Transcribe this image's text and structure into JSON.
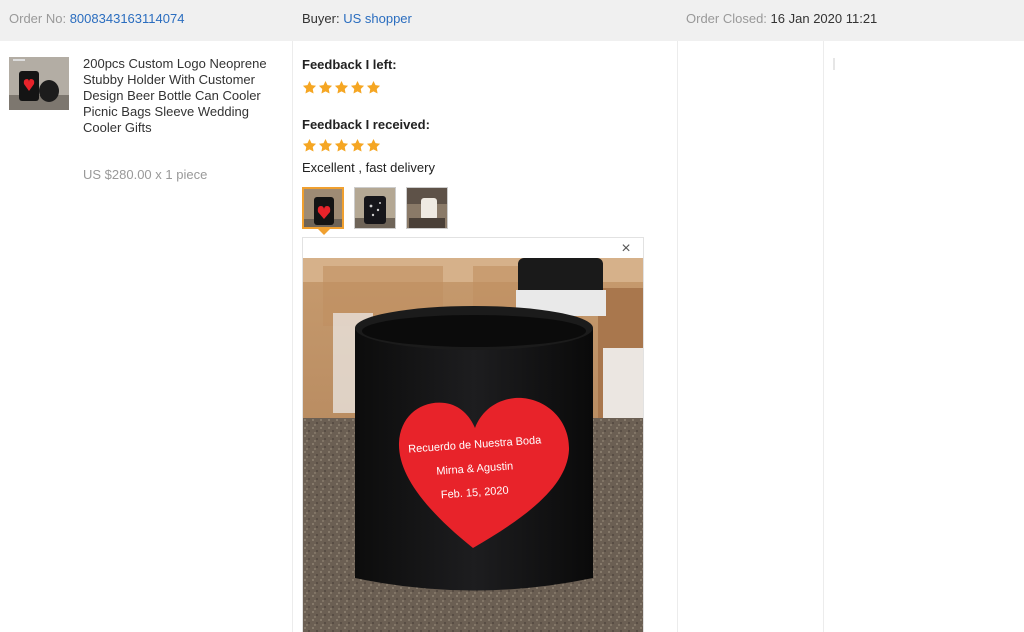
{
  "order": {
    "order_no_label": "Order No:",
    "order_no": "8008343163114074",
    "buyer_label": "Buyer:",
    "buyer": "US shopper",
    "closed_label": "Order Closed:",
    "closed_date": "16 Jan 2020 11:21"
  },
  "product": {
    "title": "200pcs Custom Logo Neoprene Stubby Holder With Customer Design Beer Bottle Can Cooler Picnic Bags Sleeve Wedding Cooler Gifts",
    "price": "US $280.00 x 1 piece"
  },
  "feedback": {
    "left_label": "Feedback I left:",
    "left_rating": 5,
    "received_label": "Feedback I received:",
    "received_rating": 5,
    "received_text": "Excellent , fast delivery",
    "photo_count": 3,
    "close_symbol": "×"
  },
  "photo_text": {
    "line1": "Recuerdo de Nuestra Boda",
    "line2": "Mirna & Agustin",
    "line3": "Feb. 15, 2020"
  },
  "colors": {
    "link": "#2a6dbf",
    "star": "#f5a623",
    "active_thumb": "#f0a030",
    "heart": "#e8232a"
  }
}
